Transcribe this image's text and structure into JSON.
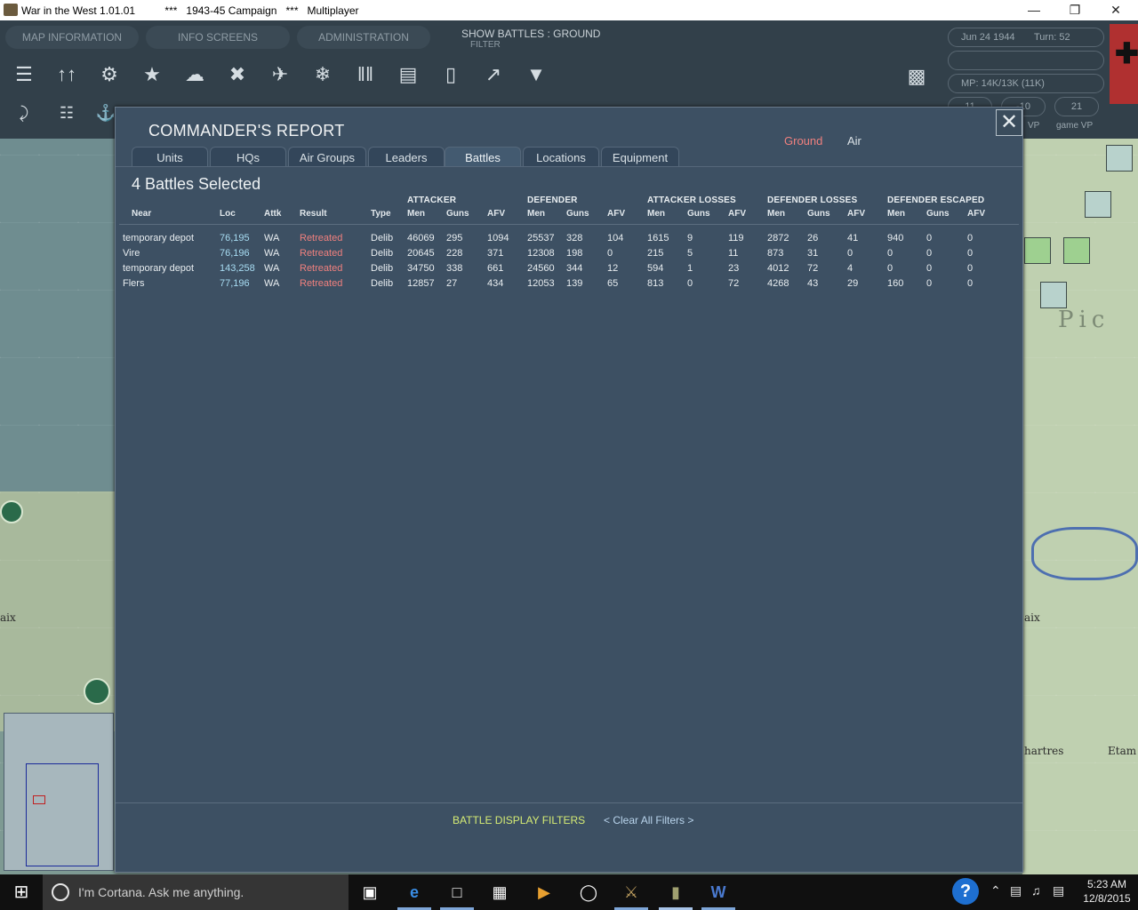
{
  "window": {
    "title": "War in the West 1.01.01          ***   1943-45 Campaign   ***   Multiplayer",
    "minimize": "—",
    "restore": "❐",
    "close": "✕"
  },
  "hud": {
    "tabs": [
      "MAP INFORMATION",
      "INFO SCREENS",
      "ADMINISTRATION"
    ],
    "show_battles": "SHOW BATTLES : GROUND",
    "filter": "FILTER",
    "date": "Jun 24 1944",
    "turn": "Turn: 52",
    "mp": "MP:  14K/13K (11K)",
    "vp_boxes": [
      "11",
      "-10",
      "21"
    ],
    "vp_label": "VP",
    "game_vp_label": "game VP",
    "tool_icons": [
      "menu-icon",
      "unit-arrows-icon",
      "gear-icon",
      "star-icon",
      "weather-icon",
      "air-mission-icon",
      "bomber-icon",
      "satellite-icon",
      "troops-icon",
      "card-icon",
      "phone-icon",
      "chart-icon",
      "supply-icon"
    ],
    "flag_color": "#b03030"
  },
  "map": {
    "labels": [
      "aix",
      "aix",
      "Pic",
      "hartres",
      "Etam"
    ]
  },
  "dialog": {
    "title": "COMMANDER'S REPORT",
    "close": "✕",
    "mode_ground": "Ground",
    "mode_air": "Air",
    "tabs": [
      "Units",
      "HQs",
      "Air Groups",
      "Leaders",
      "Battles",
      "Locations",
      "Equipment"
    ],
    "active_tab": "Battles",
    "selected_count": "4 Battles Selected",
    "groups": [
      "ATTACKER",
      "DEFENDER",
      "ATTACKER LOSSES",
      "DEFENDER LOSSES",
      "DEFENDER ESCAPED"
    ],
    "columns": [
      "Near",
      "Loc",
      "Attk",
      "Result",
      "Type",
      "Men",
      "Guns",
      "AFV",
      "Men",
      "Guns",
      "AFV",
      "Men",
      "Guns",
      "AFV",
      "Men",
      "Guns",
      "AFV",
      "Men",
      "Guns",
      "AFV"
    ],
    "rows": [
      [
        "temporary depot",
        "76,195",
        "WA",
        "Retreated",
        "Delib",
        "46069",
        "295",
        "1094",
        "25537",
        "328",
        "104",
        "1615",
        "9",
        "119",
        "2872",
        "26",
        "41",
        "940",
        "0",
        "0"
      ],
      [
        "Vire",
        "76,196",
        "WA",
        "Retreated",
        "Delib",
        "20645",
        "228",
        "371",
        "12308",
        "198",
        "0",
        "215",
        "5",
        "11",
        "873",
        "31",
        "0",
        "0",
        "0",
        "0"
      ],
      [
        "temporary depot",
        "143,258",
        "WA",
        "Retreated",
        "Delib",
        "34750",
        "338",
        "661",
        "24560",
        "344",
        "12",
        "594",
        "1",
        "23",
        "4012",
        "72",
        "4",
        "0",
        "0",
        "0"
      ],
      [
        "Flers",
        "77,196",
        "WA",
        "Retreated",
        "Delib",
        "12857",
        "27",
        "434",
        "12053",
        "139",
        "65",
        "813",
        "0",
        "72",
        "4268",
        "43",
        "29",
        "160",
        "0",
        "0"
      ]
    ],
    "filters_link": "BATTLE DISPLAY FILTERS",
    "clear_link": "< Clear All Filters >",
    "colors": {
      "result": "#f0807e",
      "loc": "#a7dcf2",
      "ground": "#f0807e",
      "filters": "#d6ec74"
    }
  },
  "taskbar": {
    "cortana": "I'm Cortana. Ask me anything.",
    "help": "?",
    "time": "5:23 AM",
    "date": "12/8/2015",
    "apps": [
      "task-view-icon",
      "edge-icon",
      "file-icon",
      "store-icon",
      "media-icon",
      "hp-icon",
      "witw-game-icon",
      "witw-tank-icon",
      "word-icon"
    ]
  }
}
